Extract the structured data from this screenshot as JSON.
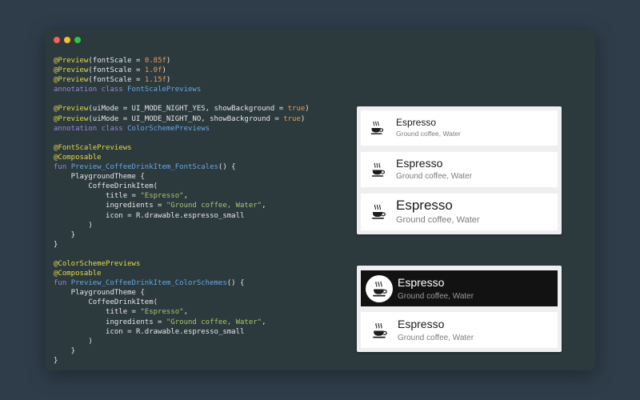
{
  "window": {
    "code_lines": [
      [
        [
          "@Preview",
          "ann"
        ],
        [
          "(fontScale = ",
          ""
        ],
        [
          "0.85f",
          "num"
        ],
        [
          ")",
          ""
        ]
      ],
      [
        [
          "@Preview",
          "ann"
        ],
        [
          "(fontScale = ",
          ""
        ],
        [
          "1.0f",
          "num"
        ],
        [
          ")",
          ""
        ]
      ],
      [
        [
          "@Preview",
          "ann"
        ],
        [
          "(fontScale = ",
          ""
        ],
        [
          "1.15f",
          "num"
        ],
        [
          ")",
          ""
        ]
      ],
      [
        [
          "annotation class ",
          "kw"
        ],
        [
          "FontScalePreviews",
          "fn"
        ]
      ],
      [],
      [
        [
          "@Preview",
          "ann"
        ],
        [
          "(uiMode = UI_MODE_NIGHT_YES, showBackground = ",
          ""
        ],
        [
          "true",
          "num"
        ],
        [
          ")",
          ""
        ]
      ],
      [
        [
          "@Preview",
          "ann"
        ],
        [
          "(uiMode = UI_MODE_NIGHT_NO, showBackground = ",
          ""
        ],
        [
          "true",
          "num"
        ],
        [
          ")",
          ""
        ]
      ],
      [
        [
          "annotation class ",
          "kw"
        ],
        [
          "ColorSchemePreviews",
          "fn"
        ]
      ],
      [],
      [
        [
          "@FontScalePreviews",
          "ann"
        ]
      ],
      [
        [
          "@Composable",
          "ann"
        ]
      ],
      [
        [
          "fun ",
          "kw"
        ],
        [
          "Preview_CoffeeDrinkItem_FontScales",
          "fn"
        ],
        [
          "() {",
          ""
        ]
      ],
      [
        [
          "    PlaygroundTheme {",
          ""
        ]
      ],
      [
        [
          "        CoffeeDrinkItem(",
          ""
        ]
      ],
      [
        [
          "            title = ",
          ""
        ],
        [
          "\"Espresso\"",
          "str"
        ],
        [
          ",",
          ""
        ]
      ],
      [
        [
          "            ingredients = ",
          ""
        ],
        [
          "\"Ground coffee, Water\"",
          "str"
        ],
        [
          ",",
          ""
        ]
      ],
      [
        [
          "            icon = R.drawable.espresso_small",
          ""
        ]
      ],
      [
        [
          "        )",
          ""
        ]
      ],
      [
        [
          "    }",
          ""
        ]
      ],
      [
        [
          "}",
          ""
        ]
      ],
      [],
      [
        [
          "@ColorSchemePreviews",
          "ann"
        ]
      ],
      [
        [
          "@Composable",
          "ann"
        ]
      ],
      [
        [
          "fun ",
          "kw"
        ],
        [
          "Preview_CoffeeDrinkItem_ColorSchemes",
          "fn"
        ],
        [
          "() {",
          ""
        ]
      ],
      [
        [
          "    PlaygroundTheme {",
          ""
        ]
      ],
      [
        [
          "        CoffeeDrinkItem(",
          ""
        ]
      ],
      [
        [
          "            title = ",
          ""
        ],
        [
          "\"Espresso\"",
          "str"
        ],
        [
          ",",
          ""
        ]
      ],
      [
        [
          "            ingredients = ",
          ""
        ],
        [
          "\"Ground coffee, Water\"",
          "str"
        ],
        [
          ",",
          ""
        ]
      ],
      [
        [
          "            icon = R.drawable.espresso_small",
          ""
        ]
      ],
      [
        [
          "        )",
          ""
        ]
      ],
      [
        [
          "    }",
          ""
        ]
      ],
      [
        [
          "}",
          ""
        ]
      ]
    ]
  },
  "font_scale_previews": [
    {
      "title": "Espresso",
      "ingredients": "Ground coffee, Water",
      "icon": "espresso-cup-icon"
    },
    {
      "title": "Espresso",
      "ingredients": "Ground coffee, Water",
      "icon": "espresso-cup-icon"
    },
    {
      "title": "Espresso",
      "ingredients": "Ground coffee, Water",
      "icon": "espresso-cup-icon"
    }
  ],
  "color_scheme_previews": [
    {
      "title": "Espresso",
      "ingredients": "Ground coffee, Water",
      "icon": "espresso-cup-icon",
      "theme": "dark"
    },
    {
      "title": "Espresso",
      "ingredients": "Ground coffee, Water",
      "icon": "espresso-cup-icon",
      "theme": "light"
    }
  ],
  "colors": {
    "background": "#2f3d4a",
    "editor": "#2c3a3e",
    "annotation": "#e4d649",
    "keyword": "#9b84d6",
    "function": "#6aa5e0",
    "number": "#e79a55",
    "string": "#a7c56a",
    "dark_card": "#121212"
  }
}
